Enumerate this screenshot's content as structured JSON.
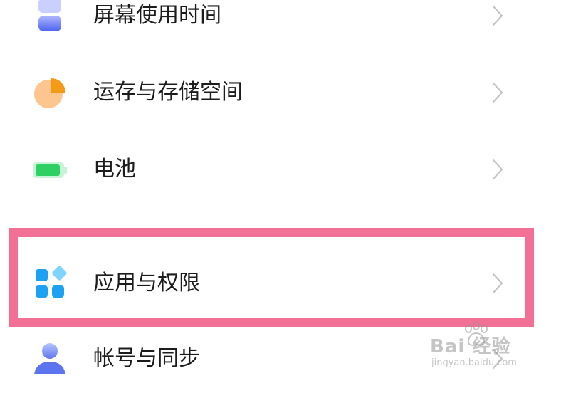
{
  "settings_list": {
    "items": [
      {
        "id": "screen-time",
        "label": "屏幕使用时间",
        "icon": "hourglass-icon"
      },
      {
        "id": "storage",
        "label": "运存与存储空间",
        "icon": "pie-chart-icon"
      },
      {
        "id": "battery",
        "label": "电池",
        "icon": "battery-icon"
      },
      {
        "id": "apps",
        "label": "应用与权限",
        "icon": "app-grid-icon"
      },
      {
        "id": "account",
        "label": "帐号与同步",
        "icon": "user-icon"
      }
    ]
  },
  "highlight": {
    "target": "apps",
    "color": "#f26f95"
  },
  "watermark": {
    "main": "Bai  经验",
    "sub": "jingyan.baidu.com"
  },
  "colors": {
    "text": "#1c1c1c",
    "chevron": "#c4c4c4",
    "highlight_border": "#f26f95",
    "screen_time_icon": "#5b6ff2",
    "storage_icon": "#f5a53b",
    "battery_icon": "#38d26b",
    "apps_icon": "#1da1f2",
    "account_icon": "#6d84f0"
  }
}
